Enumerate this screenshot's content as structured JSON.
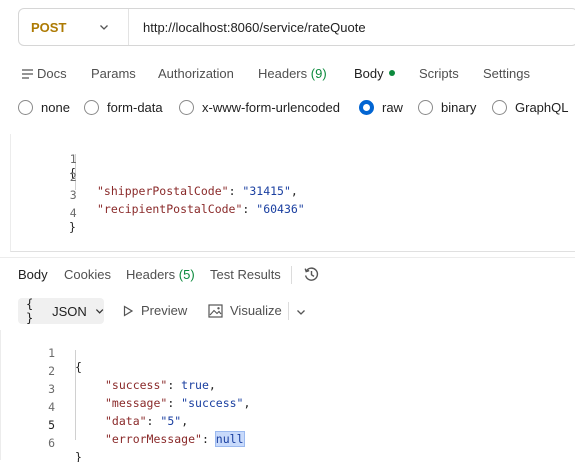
{
  "request": {
    "method": "POST",
    "url": "http://localhost:8060/service/rateQuote"
  },
  "request_tabs": {
    "docs": "Docs",
    "params": "Params",
    "authorization": "Authorization",
    "headers_label": "Headers",
    "headers_count": "(9)",
    "body": "Body",
    "scripts": "Scripts",
    "settings": "Settings"
  },
  "body_types": {
    "none": "none",
    "form_data": "form-data",
    "urlencoded": "x-www-form-urlencoded",
    "raw": "raw",
    "binary": "binary",
    "graphql": "GraphQL",
    "selected": "raw"
  },
  "request_body": {
    "line_numbers": [
      "1",
      "2",
      "3",
      "4"
    ],
    "open_brace": "{",
    "close_brace": "}",
    "pairs": [
      {
        "key": "\"shipperPostalCode\"",
        "value": "\"31415\"",
        "trail": ","
      },
      {
        "key": "\"recipientPostalCode\"",
        "value": "\"60436\"",
        "trail": ""
      }
    ]
  },
  "response_tabs": {
    "body": "Body",
    "cookies": "Cookies",
    "headers_label": "Headers",
    "headers_count": "(5)",
    "test_results": "Test Results"
  },
  "response_toolbar": {
    "format": "JSON",
    "format_icon": "{ }",
    "preview": "Preview",
    "visualize": "Visualize"
  },
  "response_body": {
    "line_numbers": [
      "1",
      "2",
      "3",
      "4",
      "5",
      "6"
    ],
    "open_brace": "{",
    "close_brace": "}",
    "pairs": [
      {
        "key": "\"success\"",
        "value": "true",
        "trail": ","
      },
      {
        "key": "\"message\"",
        "value": "\"success\"",
        "trail": ","
      },
      {
        "key": "\"data\"",
        "value": "\"5\"",
        "trail": ","
      },
      {
        "key": "\"errorMessage\"",
        "value": "null",
        "trail": ""
      }
    ]
  },
  "colors": {
    "method": "#ad7a03",
    "accent": "#0265d2",
    "status_dot": "#0c8a3d",
    "json_key": "#8a2a2a",
    "json_value": "#1a3fa0"
  }
}
